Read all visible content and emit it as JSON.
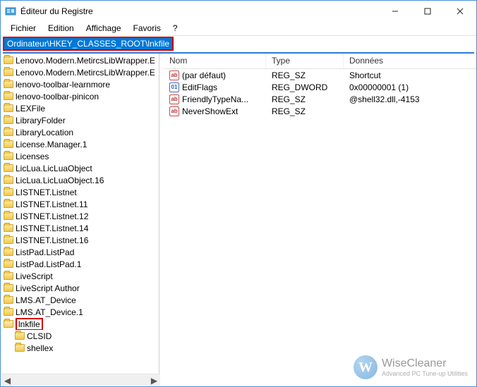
{
  "window": {
    "title": "Éditeur du Registre",
    "menu": {
      "file": "Fichier",
      "edit": "Edition",
      "view": "Affichage",
      "favorites": "Favoris",
      "help": "?"
    },
    "address": "Ordinateur\\HKEY_CLASSES_ROOT\\lnkfile"
  },
  "tree": {
    "items": [
      {
        "label": "Lenovo.Modern.MetircsLibWrapper.E",
        "indent": 0
      },
      {
        "label": "Lenovo.Modern.MetircsLibWrapper.E",
        "indent": 0
      },
      {
        "label": "lenovo-toolbar-learnmore",
        "indent": 0
      },
      {
        "label": "lenovo-toolbar-pinicon",
        "indent": 0
      },
      {
        "label": "LEXFile",
        "indent": 0
      },
      {
        "label": "LibraryFolder",
        "indent": 0
      },
      {
        "label": "LibraryLocation",
        "indent": 0
      },
      {
        "label": "License.Manager.1",
        "indent": 0
      },
      {
        "label": "Licenses",
        "indent": 0
      },
      {
        "label": "LicLua.LicLuaObject",
        "indent": 0
      },
      {
        "label": "LicLua.LicLuaObject.16",
        "indent": 0
      },
      {
        "label": "LISTNET.Listnet",
        "indent": 0
      },
      {
        "label": "LISTNET.Listnet.11",
        "indent": 0
      },
      {
        "label": "LISTNET.Listnet.12",
        "indent": 0
      },
      {
        "label": "LISTNET.Listnet.14",
        "indent": 0
      },
      {
        "label": "LISTNET.Listnet.16",
        "indent": 0
      },
      {
        "label": "ListPad.ListPad",
        "indent": 0
      },
      {
        "label": "ListPad.ListPad.1",
        "indent": 0
      },
      {
        "label": "LiveScript",
        "indent": 0
      },
      {
        "label": "LiveScript Author",
        "indent": 0
      },
      {
        "label": "LMS.AT_Device",
        "indent": 0
      },
      {
        "label": "LMS.AT_Device.1",
        "indent": 0
      },
      {
        "label": "lnkfile",
        "indent": 0,
        "highlighted": true,
        "open": true
      },
      {
        "label": "CLSID",
        "indent": 1
      },
      {
        "label": "shellex",
        "indent": 1
      }
    ]
  },
  "list": {
    "columns": {
      "name": "Nom",
      "type": "Type",
      "data": "Données"
    },
    "rows": [
      {
        "icon": "str",
        "name": "(par défaut)",
        "type": "REG_SZ",
        "data": "Shortcut"
      },
      {
        "icon": "bin",
        "name": "EditFlags",
        "type": "REG_DWORD",
        "data": "0x00000001 (1)"
      },
      {
        "icon": "str",
        "name": "FriendlyTypeNa...",
        "type": "REG_SZ",
        "data": "@shell32.dll,-4153"
      },
      {
        "icon": "str",
        "name": "NeverShowExt",
        "type": "REG_SZ",
        "data": ""
      }
    ]
  },
  "watermark": {
    "brand": "WiseCleaner",
    "tagline": "Advanced PC Tune-up Utilities",
    "logo_letter": "W"
  }
}
